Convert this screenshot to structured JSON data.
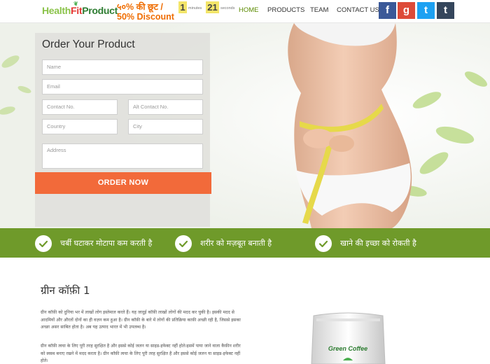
{
  "header": {
    "logo": {
      "part1": "Health",
      "part2": "Fit",
      "part3": "Product"
    },
    "promo_line1": "५०% की छूट /",
    "promo_line2": "50% Discount",
    "timer": {
      "minutes_value": "1",
      "minutes_label": "minutes",
      "seconds_value": "21",
      "seconds_label": "seconds"
    },
    "nav": [
      "HOME",
      "PRODUCTS",
      "TEAM",
      "CONTACT US"
    ],
    "social": [
      {
        "icon": "facebook-icon",
        "glyph": "f",
        "color": "#3b5998"
      },
      {
        "icon": "google-plus-icon",
        "glyph": "g",
        "color": "#dd4b39"
      },
      {
        "icon": "twitter-icon",
        "glyph": "t",
        "color": "#1da1f2"
      },
      {
        "icon": "tumblr-icon",
        "glyph": "t",
        "color": "#35465c"
      }
    ]
  },
  "form": {
    "title": "Order Your Product",
    "placeholders": {
      "name": "Name",
      "email": "Email",
      "contact": "Contact No.",
      "alt_contact": "Alt Contact No.",
      "country": "Country",
      "city": "City",
      "address": "Address"
    },
    "submit_label": "ORDER NOW"
  },
  "features": [
    "चर्बी घटाकर मोटापा कम करती है",
    "शरीर को मज़बूत बनाती है",
    "खाने की इच्छा को रोकती है"
  ],
  "content": {
    "title": "ग्रीन कॉफ़ी 1",
    "para1": "ग्रीन कॉफ़ी को दुनिया भर में लाखों लोग इस्तेमाल करते हैं। यह जादुई कॉफ़ी लाखों लोगों की मदद कर चुकी है। इसकी मदद से आदमियों और औरतों दोनों का ही वज़न कम हुआ है। ग्रीन कॉफ़ी के बारे में लोगों की प्रतिक्रिया काफ़ी अच्छी रही है, जिससे इसका अच्छा असर साबित होता है। अब यह उत्पाद भारत में भी उपलब्ध है।",
    "para2": "ग्रीन कॉफ़ी त्वचा के लिए पूरी तरह सुरक्षित है और इससे कोई जलन या साइड-इफेक्ट नहीं होते।इसमें पाया जाने वाला कैफ़ीन शरीर को स्वस्थ बनाए रखने में मदद करता है। ग्रीन कॉफ़ी त्वचा के लिए पूरी तरह सुरक्षित है और इससे कोई जलन या साइड-इफेक्ट नहीं होते।",
    "pack_label": "Green Coffee"
  },
  "colors": {
    "accent_green": "#6f9a2a",
    "order_button": "#f26a3a",
    "timer_bg": "#f3e56a",
    "promo": "#ef6c00"
  }
}
